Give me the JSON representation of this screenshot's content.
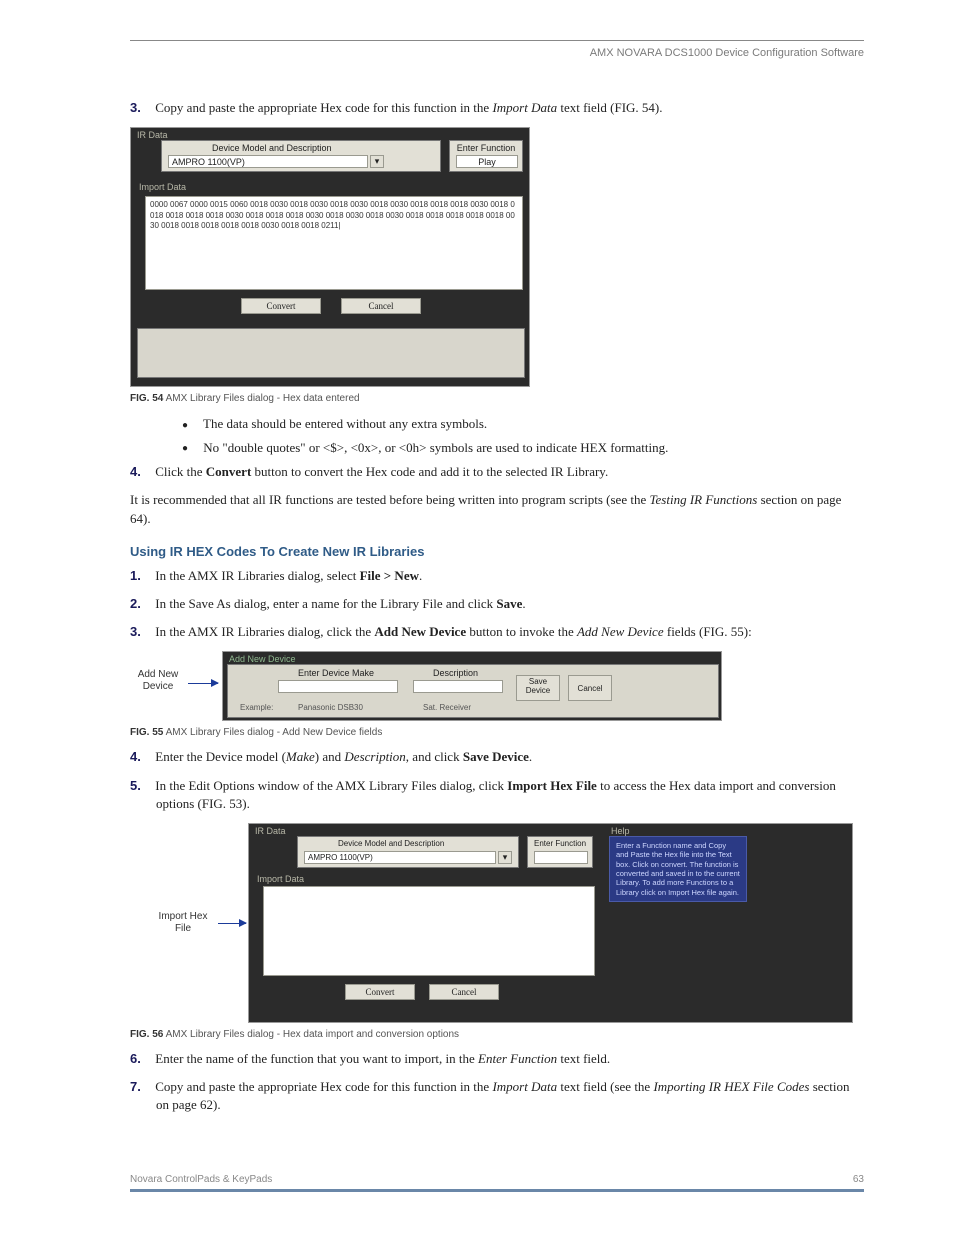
{
  "header": {
    "title": "AMX NOVARA DCS1000 Device Configuration Software"
  },
  "sec1": {
    "step3": {
      "num": "3.",
      "text_a": "Copy and paste the appropriate Hex code for this function in the ",
      "text_b": "Import Data",
      "text_c": " text field (FIG. 54)."
    },
    "fig54": {
      "ir_label": "IR Data",
      "dm_label": "Device Model and Description",
      "dm_value": "AMPRO 1100(VP)",
      "ef_label": "Enter Function",
      "ef_value": "Play",
      "import_label": "Import Data",
      "hex": "0000 0067 0000 0015 0060 0018 0030 0018 0030 0018 0030 0018 0030 0018 0018 0018 0030 0018 0018 0018 0018 0018 0030 0018 0018 0018 0030 0018 0030 0018 0030 0018 0018 0018 0018 0018 0030 0018 0018 0018 0018 0018 0030 0018 0018 0211|",
      "convert": "Convert",
      "cancel": "Cancel",
      "caption_b": "FIG. 54",
      "caption": "  AMX Library Files dialog - Hex data entered"
    },
    "bullets": {
      "b1": "The data should be entered without any extra symbols.",
      "b2": "No \"double quotes\" or <$>, <0x>, or <0h> symbols are used to indicate HEX formatting."
    },
    "step4": {
      "num": "4.",
      "a": "Click the ",
      "b": "Convert",
      "c": " button to convert the Hex code and add it to the selected IR Library."
    },
    "rec": {
      "a": "It is recommended that all IR functions are tested before being written into program scripts (see the ",
      "b": "Testing IR Functions",
      "c": " section on page 64)."
    }
  },
  "sec2": {
    "heading": "Using IR HEX Codes To Create New IR Libraries",
    "s1": {
      "num": "1.",
      "a": "In the AMX IR Libraries dialog, select ",
      "b": "File > New",
      "c": "."
    },
    "s2": {
      "num": "2.",
      "a": "In the Save As dialog, enter a name for the Library File and click ",
      "b": "Save",
      "c": "."
    },
    "s3": {
      "num": "3.",
      "a": "In the AMX IR Libraries dialog, click the ",
      "b": "Add New Device",
      "c": " button to invoke the ",
      "d": "Add New Device",
      "e": " fields (FIG. 55):"
    },
    "fig55": {
      "callout": "Add New\nDevice",
      "group": "Add New Device",
      "make_label": "Enter Device Make",
      "desc_label": "Description",
      "save_btn": "Save\nDevice",
      "cancel_btn": "Cancel",
      "example": "Example:",
      "make_ex": "Panasonic DSB30",
      "desc_ex": "Sat. Receiver",
      "caption_b": "FIG. 55",
      "caption": "  AMX Library Files dialog - Add New Device fields"
    },
    "s4": {
      "num": "4.",
      "a": "Enter the Device model (",
      "b": "Make",
      "c": ") and ",
      "d": "Description",
      "e": ", and click ",
      "f": "Save Device",
      "g": "."
    },
    "s5": {
      "num": "5.",
      "a": "In the Edit Options window of the AMX Library Files dialog, click ",
      "b": "Import Hex File",
      "c": " to access the Hex data import and conversion options (FIG. 53)."
    },
    "fig56": {
      "callout": "Import Hex\nFile",
      "ir_label": "IR Data",
      "dm_label": "Device Model and Description",
      "dm_value": "AMPRO 1100(VP)",
      "ef_label": "Enter Function",
      "import_label": "Import Data",
      "convert": "Convert",
      "cancel": "Cancel",
      "help_label": "Help",
      "help_text": "Enter a Function name and Copy and Paste the Hex file into the Text box. Click on convert. The function is converted and saved in to the current Library. To add more Functions to a Library click on Import Hex file again.",
      "caption_b": "FIG. 56",
      "caption": "  AMX Library Files dialog - Hex data import and conversion options"
    },
    "s6": {
      "num": "6.",
      "a": "Enter the name of the function that you want to import, in the ",
      "b": "Enter Function",
      "c": " text field."
    },
    "s7": {
      "num": "7.",
      "a": "Copy and paste the appropriate Hex code for this function in the ",
      "b": "Import Data",
      "c": " text field (see the ",
      "d": "Importing IR HEX File Codes",
      "e": " section on page 62)."
    }
  },
  "footer": {
    "left": "Novara ControlPads & KeyPads",
    "right": "63"
  }
}
